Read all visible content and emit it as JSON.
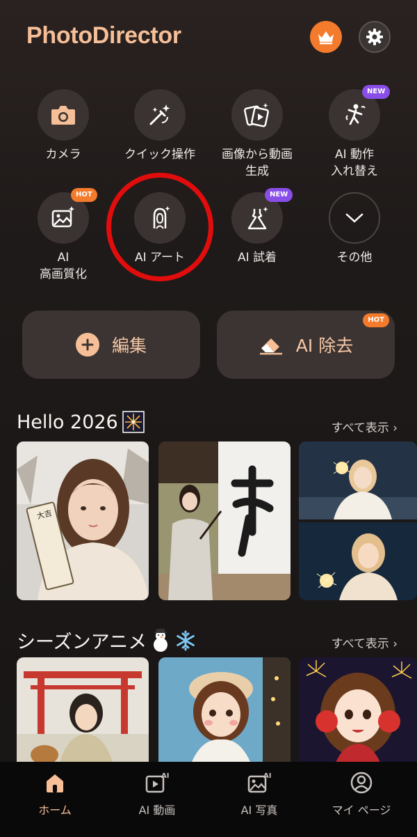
{
  "header": {
    "title": "PhotoDirector",
    "premium_icon": "crown-icon",
    "settings_icon": "gear-icon"
  },
  "tools": [
    {
      "label": "カメラ",
      "icon": "camera-icon"
    },
    {
      "label": "クイック操作",
      "icon": "magic-wand-icon"
    },
    {
      "label": "画像から動画\n生成",
      "icon": "image-to-video-icon"
    },
    {
      "label": "AI 動作\n入れ替え",
      "icon": "dancing-figure-icon",
      "badge": "NEW"
    },
    {
      "label": "AI\n高画質化",
      "icon": "enhance-image-icon",
      "badge": "HOT"
    },
    {
      "label": "AI アート",
      "icon": "ai-portrait-icon"
    },
    {
      "label": "AI 試着",
      "icon": "dress-icon",
      "badge": "NEW"
    },
    {
      "label": "その他",
      "icon": "chevron-down-icon"
    }
  ],
  "actions": {
    "edit_label": "編集",
    "remove_label": "AI 除去",
    "remove_badge": "HOT"
  },
  "sections": [
    {
      "title": "Hello 2026",
      "see_all": "すべて表示 ›"
    },
    {
      "title": "シーズンアニメ",
      "see_all": "すべて表示 ›"
    }
  ],
  "bottom_nav": [
    {
      "label": "ホーム",
      "icon": "home-icon",
      "active": true
    },
    {
      "label": "AI 動画",
      "icon": "ai-video-icon"
    },
    {
      "label": "AI 写真",
      "icon": "ai-photo-icon"
    },
    {
      "label": "マイ ページ",
      "icon": "user-icon"
    }
  ],
  "colors": {
    "accent": "#f6bf98",
    "hot_badge": "#f47a2c",
    "new_badge": "#8a4ee8",
    "highlight": "#e10d0d"
  }
}
